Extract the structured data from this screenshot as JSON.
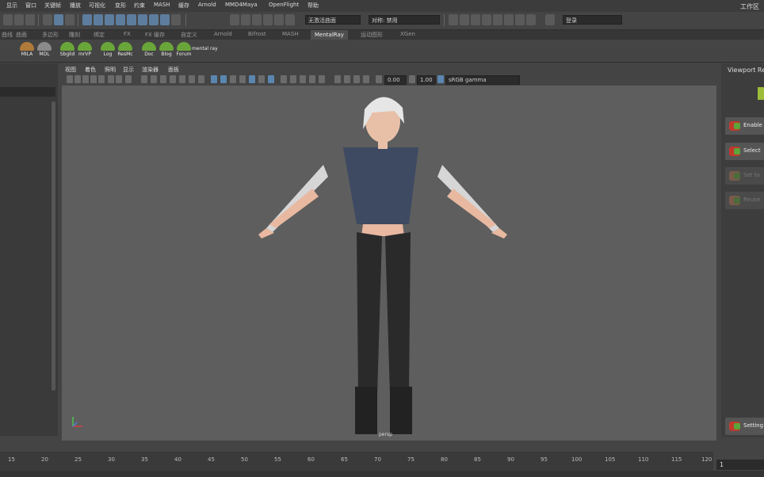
{
  "menubar": {
    "items": [
      "显示",
      "窗口",
      "关键帧",
      "播放",
      "可视化",
      "变形",
      "约束",
      "MASH",
      "缓存",
      "Arnold",
      "MMD4Maya",
      "OpenFlight",
      "帮助"
    ],
    "workspace_label": "工作区"
  },
  "statusline": {
    "live_surface": "无激活曲面",
    "symmetry": "对称: 禁用",
    "user": "登录"
  },
  "shelf_tabs": [
    "曲线",
    "曲面",
    "多边形",
    "雕刻",
    "绑定",
    "动画",
    "渲染",
    "FX",
    "FX 缓存",
    "自定义",
    "Arnold",
    "Bifrost",
    "MASH",
    "MentalRay",
    "运动图形",
    "XGen"
  ],
  "shelf_active": "MentalRay",
  "shelf_buttons": [
    "MILA",
    "MDL",
    "Sbglid",
    "mrVP",
    "Log",
    "ResMc",
    "Doc",
    "Blog",
    "Forum",
    "mental ray"
  ],
  "viewport": {
    "menus": [
      "视图",
      "着色",
      "照明",
      "显示",
      "渲染器",
      "面板"
    ],
    "exposure": "0.00",
    "gamma": "1.00",
    "color_space": "sRGB gamma",
    "camera": "persp"
  },
  "right_panel": {
    "title": "Viewport Re",
    "buttons": [
      {
        "label": "Enable",
        "enabled": true
      },
      {
        "label": "Select",
        "enabled": true
      },
      {
        "label": "Set to",
        "enabled": false
      },
      {
        "label": "Reuse",
        "enabled": false
      },
      {
        "label": "Setting",
        "enabled": true
      }
    ]
  },
  "timeline": {
    "ticks": [
      "15",
      "20",
      "25",
      "30",
      "35",
      "40",
      "45",
      "50",
      "55",
      "60",
      "65",
      "70",
      "75",
      "80",
      "85",
      "90",
      "95",
      "100",
      "105",
      "110",
      "115",
      "120"
    ],
    "current_frame": "1"
  },
  "colors": {
    "viewport_bg": "#5e5e5e",
    "ui_bg": "#444444",
    "accent": "#5d7d9e",
    "shelf_icon": "#6aa53a"
  }
}
